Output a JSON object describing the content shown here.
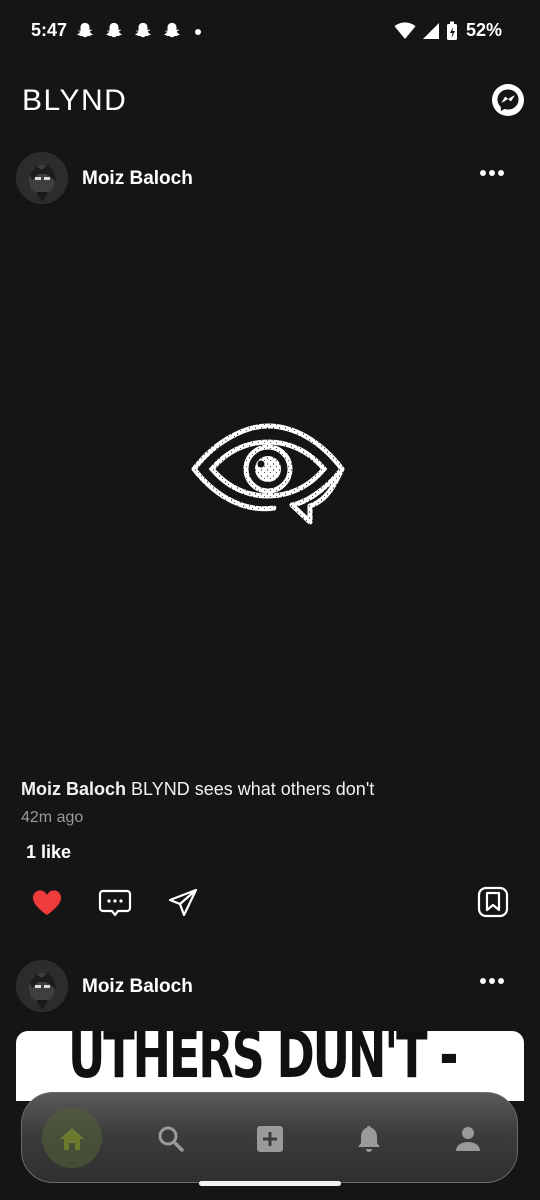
{
  "status_bar": {
    "time": "5:47",
    "notification_icons": [
      "snapchat-icon",
      "snapchat-icon",
      "snapchat-icon",
      "snapchat-icon"
    ],
    "battery": "52%"
  },
  "app": {
    "title": "BLYND",
    "messenger_icon": "messenger-icon"
  },
  "posts": [
    {
      "author": "Moiz Baloch",
      "caption_author": "Moiz Baloch",
      "caption_text": "BLYND sees what others don't",
      "time_ago": "42m ago",
      "likes": "1 like",
      "liked": true
    },
    {
      "author": "Moiz Baloch",
      "image_text": "UTHERS DUN'T -"
    }
  ],
  "bottom_nav": {
    "items": [
      "home-icon",
      "search-icon",
      "add-icon",
      "bell-icon",
      "profile-icon"
    ],
    "active": "home-icon"
  },
  "colors": {
    "background": "#151515",
    "like_red": "#ee3b3b",
    "active_nav": "#6b7a2e"
  }
}
